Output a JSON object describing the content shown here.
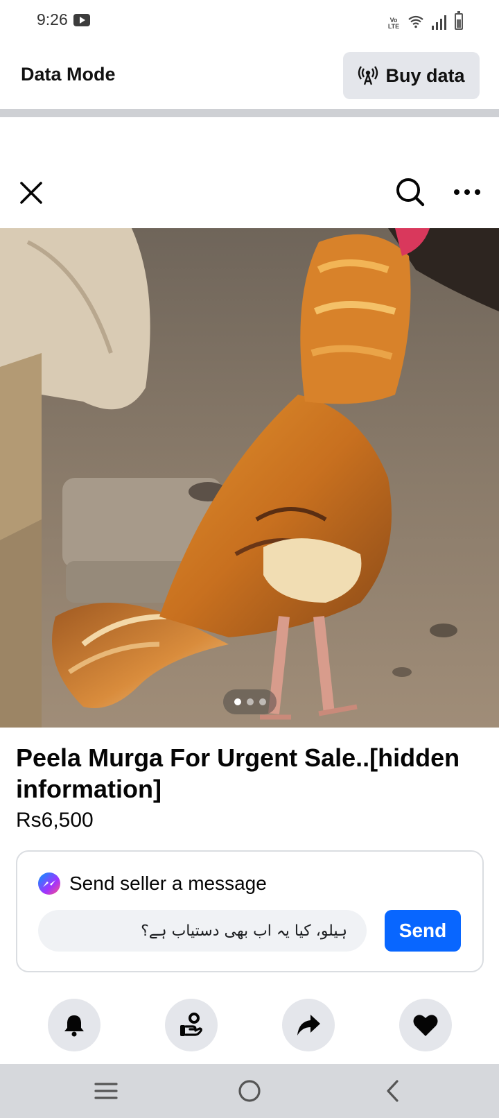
{
  "status_bar": {
    "time": "9:26",
    "volte_label": "VoLTE",
    "icons": [
      "youtube-icon",
      "volte-icon",
      "wifi-icon",
      "signal-icon",
      "battery-icon"
    ]
  },
  "data_mode": {
    "title": "Data Mode",
    "buy_label": "Buy data",
    "buy_icon": "antenna-icon"
  },
  "header": {
    "icons": [
      "close-icon",
      "search-icon",
      "more-icon"
    ]
  },
  "photo": {
    "image_count": 3,
    "active_index": 0
  },
  "listing": {
    "title": "Peela Murga For Urgent Sale..[hidden information]",
    "price": "Rs6,500"
  },
  "message": {
    "heading": "Send seller a message",
    "input_value": "ہیلو، کیا یہ اب بھی دستیاب ہے؟",
    "send_label": "Send"
  },
  "actions": [
    {
      "name": "notify",
      "icon": "bell-icon"
    },
    {
      "name": "make-offer",
      "icon": "hand-coin-icon"
    },
    {
      "name": "share",
      "icon": "share-arrow-icon"
    },
    {
      "name": "save",
      "icon": "heart-icon"
    }
  ],
  "nav": {
    "icons": [
      "recents-icon",
      "home-icon",
      "back-icon"
    ]
  },
  "colors": {
    "accent": "#0866ff",
    "button_gray": "#e4e6eb",
    "input_bg": "#f0f2f5",
    "nav_bar": "#d6d8dc"
  }
}
